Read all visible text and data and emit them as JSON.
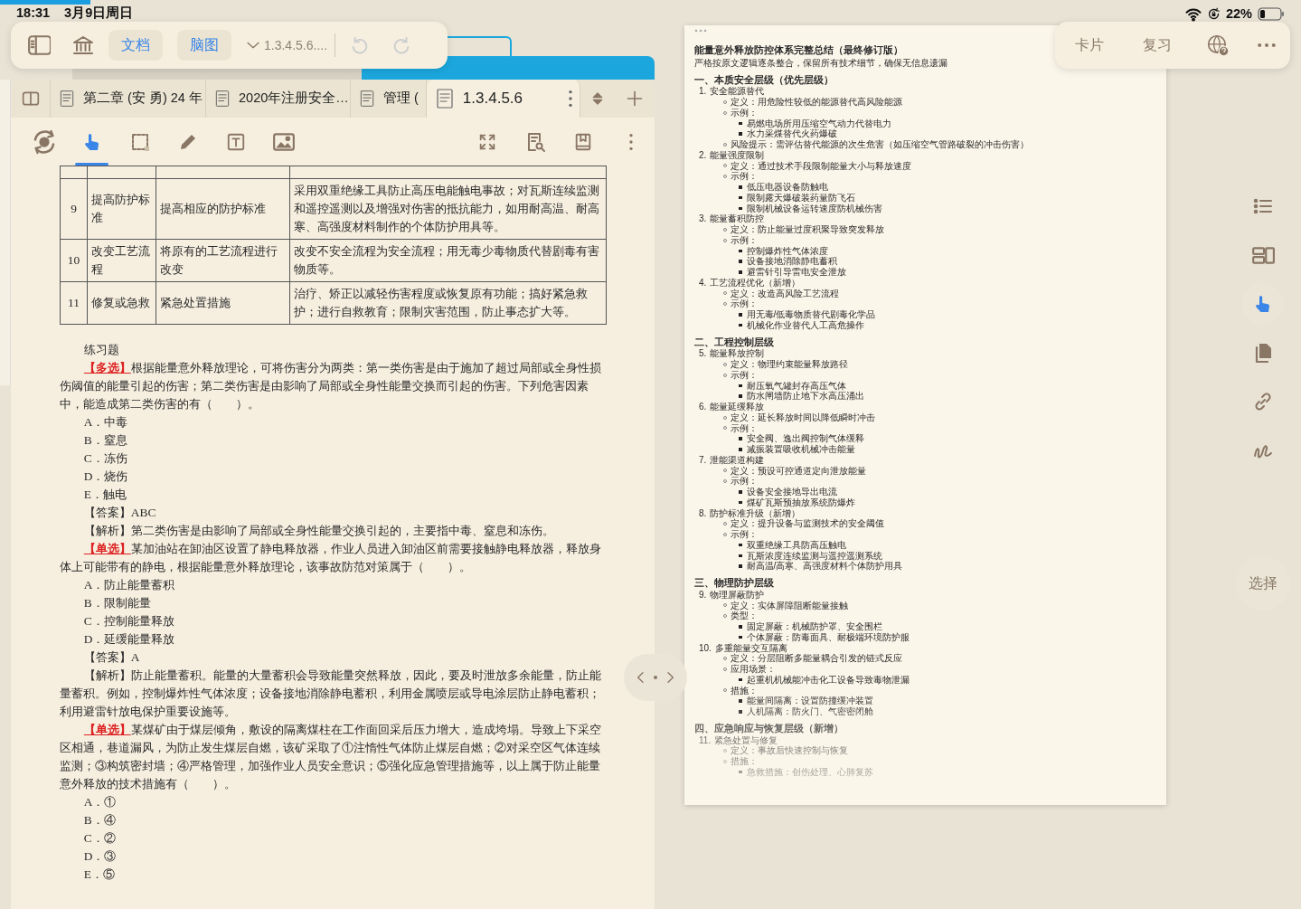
{
  "status_bar": {
    "time": "18:31",
    "date": "3月9日周日",
    "battery": "22%"
  },
  "top_toolbar": {
    "view_buttons": [
      {
        "label": "文档"
      },
      {
        "label": "脑图"
      }
    ],
    "breadcrumb": "1.3.4.5.6...."
  },
  "doc_tabs": [
    {
      "label": "第二章 (安 勇) 24 年",
      "selected": false
    },
    {
      "label": "2020年注册安全…",
      "selected": false
    },
    {
      "label": "管理 (",
      "selected": false
    },
    {
      "label": "1.3.4.5.6",
      "selected": true
    }
  ],
  "tools": [
    {
      "kind": "sync",
      "selected": false
    },
    {
      "kind": "hand",
      "selected": true
    },
    {
      "kind": "crop",
      "selected": false
    },
    {
      "kind": "pencil",
      "selected": false
    },
    {
      "kind": "textbox",
      "selected": false
    },
    {
      "kind": "image",
      "selected": false
    }
  ],
  "table": {
    "rows": [
      {
        "cells": [
          "9",
          "提高防护标准",
          "提高相应的防护标准",
          "采用双重绝缘工具防止高压电能触电事故；对瓦斯连续监测和遥控遥测以及增强对伤害的抵抗能力，如用耐高温、耐高寒、高强度材料制作的个体防护用具等。"
        ]
      },
      {
        "cells": [
          "10",
          "改变工艺流程",
          "将原有的工艺流程进行改变",
          "改变不安全流程为安全流程；用无毒少毒物质代替剧毒有害物质等。"
        ]
      },
      {
        "cells": [
          "11",
          "修复或急救",
          "紧急处置措施",
          "治疗、矫正以减轻伤害程度或恢复原有功能；搞好紧急救护；进行自救教育；限制灾害范围，防止事态扩大等。"
        ]
      }
    ]
  },
  "exercises": [
    {
      "kind": "heading",
      "text": "练习题"
    },
    {
      "kind": "question",
      "tag": "【多选】",
      "text": "根据能量意外释放理论，可将伤害分为两类：第一类伤害是由于施加了超过局部或全身性损伤阈值的能量引起的伤害；第二类伤害是由影响了局部或全身性能量交换而引起的伤害。下列危害因素中，能造成第二类伤害的有（　　）。"
    },
    {
      "kind": "option",
      "text": "A．中毒"
    },
    {
      "kind": "option",
      "text": "B．窒息"
    },
    {
      "kind": "option",
      "text": "C．冻伤"
    },
    {
      "kind": "option",
      "text": "D．烧伤"
    },
    {
      "kind": "option",
      "text": "E．触电"
    },
    {
      "kind": "answer",
      "text": "【答案】ABC"
    },
    {
      "kind": "analysis",
      "text": "【解析】第二类伤害是由影响了局部或全身性能量交换引起的，主要指中毒、窒息和冻伤。"
    },
    {
      "kind": "question",
      "tag": "【单选】",
      "text": "某加油站在卸油区设置了静电释放器，作业人员进入卸油区前需要接触静电释放器，释放身体上可能带有的静电，根据能量意外释放理论，该事故防范对策属于（　　）。"
    },
    {
      "kind": "option",
      "text": "A．防止能量蓄积"
    },
    {
      "kind": "option",
      "text": "B．限制能量"
    },
    {
      "kind": "option",
      "text": "C．控制能量释放"
    },
    {
      "kind": "option",
      "text": "D．延缓能量释放"
    },
    {
      "kind": "answer",
      "text": "【答案】A"
    },
    {
      "kind": "analysis",
      "text": "【解析】防止能量蓄积。能量的大量蓄积会导致能量突然释放，因此，要及时泄放多余能量，防止能量蓄积。例如，控制爆炸性气体浓度；设备接地消除静电蓄积，利用金属喷层或导电涂层防止静电蓄积；利用避雷针放电保护重要设施等。"
    },
    {
      "kind": "question",
      "tag": "【单选】",
      "text": "某煤矿由于煤层倾角，敷设的隔离煤柱在工作面回采后压力增大，造成垮塌。导致上下采空区相通，巷道漏风，为防止发生煤层自燃，该矿采取了①注惰性气体防止煤层自燃；②对采空区气体连续监测；③构筑密封墙；④严格管理，加强作业人员安全意识；⑤强化应急管理措施等，以上属于防止能量意外释放的技术措施有（　　）。"
    },
    {
      "kind": "option",
      "text": "A．①"
    },
    {
      "kind": "option",
      "text": "B．④"
    },
    {
      "kind": "option",
      "text": "C．②"
    },
    {
      "kind": "option",
      "text": "D．③"
    },
    {
      "kind": "option",
      "text": "E．⑤"
    }
  ],
  "right_toolbar": {
    "buttons": [
      {
        "label": "卡片"
      },
      {
        "label": "复习"
      }
    ]
  },
  "outline": {
    "title": "能量意外释放防控体系完整总结（最终修订版）",
    "subtitle": "严格按原文逻辑逐条整合，保留所有技术细节，确保无信息遗漏",
    "sections": [
      {
        "title": "一、本质安全层级（优先层级）",
        "items": [
          {
            "number": "1.",
            "text": "安全能源替代",
            "children": [
              {
                "text": "定义：用危险性较低的能源替代高风险能源"
              },
              {
                "text": "示例：",
                "children": [
                  {
                    "text": "易燃电场所用压缩空气动力代替电力"
                  },
                  {
                    "text": "水力采煤替代火药爆破"
                  }
                ]
              },
              {
                "text": "风险提示：需评估替代能源的次生危害（如压缩空气管路破裂的冲击伤害）"
              }
            ]
          },
          {
            "number": "2.",
            "text": "能量强度限制",
            "children": [
              {
                "text": "定义：通过技术手段限制能量大小与释放速度"
              },
              {
                "text": "示例：",
                "children": [
                  {
                    "text": "低压电器设备防触电"
                  },
                  {
                    "text": "限制露天爆破装药量防飞石"
                  },
                  {
                    "text": "限制机械设备运转速度防机械伤害"
                  }
                ]
              }
            ]
          },
          {
            "number": "3.",
            "text": "能量蓄积防控",
            "children": [
              {
                "text": "定义：防止能量过度积聚导致突发释放"
              },
              {
                "text": "示例：",
                "children": [
                  {
                    "text": "控制爆炸性气体浓度"
                  },
                  {
                    "text": "设备接地消除静电蓄积"
                  },
                  {
                    "text": "避雷针引导雷电安全泄放"
                  }
                ]
              }
            ]
          },
          {
            "number": "4.",
            "text": "工艺流程优化（新增）",
            "children": [
              {
                "text": "定义：改造高风险工艺流程"
              },
              {
                "text": "示例：",
                "children": [
                  {
                    "text": "用无毒/低毒物质替代剧毒化学品"
                  },
                  {
                    "text": "机械化作业替代人工高危操作"
                  }
                ]
              }
            ]
          }
        ]
      },
      {
        "title": "二、工程控制层级",
        "items": [
          {
            "number": "5.",
            "text": "能量释放控制",
            "children": [
              {
                "text": "定义：物理约束能量释放路径"
              },
              {
                "text": "示例：",
                "children": [
                  {
                    "text": "耐压氧气罐封存高压气体"
                  },
                  {
                    "text": "防水闸墙防止地下水高压涌出"
                  }
                ]
              }
            ]
          },
          {
            "number": "6.",
            "text": "能量延缓释放",
            "children": [
              {
                "text": "定义：延长释放时间以降低瞬时冲击"
              },
              {
                "text": "示例：",
                "children": [
                  {
                    "text": "安全阀、逸出阀控制气体缓释"
                  },
                  {
                    "text": "减振装置吸收机械冲击能量"
                  }
                ]
              }
            ]
          },
          {
            "number": "7.",
            "text": "泄能渠道构建",
            "children": [
              {
                "text": "定义：预设可控通道定向泄放能量"
              },
              {
                "text": "示例：",
                "children": [
                  {
                    "text": "设备安全接地导出电流"
                  },
                  {
                    "text": "煤矿瓦斯预抽放系统防爆炸"
                  }
                ]
              }
            ]
          },
          {
            "number": "8.",
            "text": "防护标准升级（新增）",
            "children": [
              {
                "text": "定义：提升设备与监测技术的安全阈值"
              },
              {
                "text": "示例：",
                "children": [
                  {
                    "text": "双重绝缘工具防高压触电"
                  },
                  {
                    "text": "瓦斯浓度连续监测与遥控遥测系统"
                  },
                  {
                    "text": "耐高温/高寒、高强度材料个体防护用具"
                  }
                ]
              }
            ]
          }
        ]
      },
      {
        "title": "三、物理防护层级",
        "items": [
          {
            "number": "9.",
            "text": "物理屏蔽防护",
            "children": [
              {
                "text": "定义：实体屏障阻断能量接触"
              },
              {
                "text": "类型：",
                "children": [
                  {
                    "text": "固定屏蔽：机械防护罩、安全围栏"
                  },
                  {
                    "text": "个体屏蔽：防毒面具、耐极端环境防护服"
                  }
                ]
              }
            ]
          },
          {
            "number": "10.",
            "text": "多重能量交互隔离",
            "children": [
              {
                "text": "定义：分层阻断多能量耦合引发的链式反应"
              },
              {
                "text": "应用场景：",
                "children": [
                  {
                    "text": "起重机机械能冲击化工设备导致毒物泄漏"
                  }
                ]
              },
              {
                "text": "措施：",
                "children": [
                  {
                    "text": "能量间隔离：设置防撞缓冲装置"
                  },
                  {
                    "text": "人机隔离：防火门、气密密闭舱"
                  }
                ]
              }
            ]
          }
        ]
      },
      {
        "title": "四、应急响应与恢复层级（新增）",
        "items": [
          {
            "number": "11.",
            "text": "紧急处置与修复",
            "children": [
              {
                "text": "定义：事故后快速控制与恢复"
              },
              {
                "text": "措施：",
                "children": [
                  {
                    "text": "急救措施：创伤处理、心肺复苏"
                  }
                ]
              }
            ]
          }
        ]
      }
    ]
  },
  "side_tools": [
    {
      "kind": "list",
      "selected": false
    },
    {
      "kind": "layout",
      "selected": false
    },
    {
      "kind": "hand",
      "selected": true
    },
    {
      "kind": "copy",
      "selected": false
    },
    {
      "kind": "link",
      "selected": false
    },
    {
      "kind": "squiggle",
      "selected": false
    }
  ],
  "select_button": {
    "label": "选择"
  }
}
